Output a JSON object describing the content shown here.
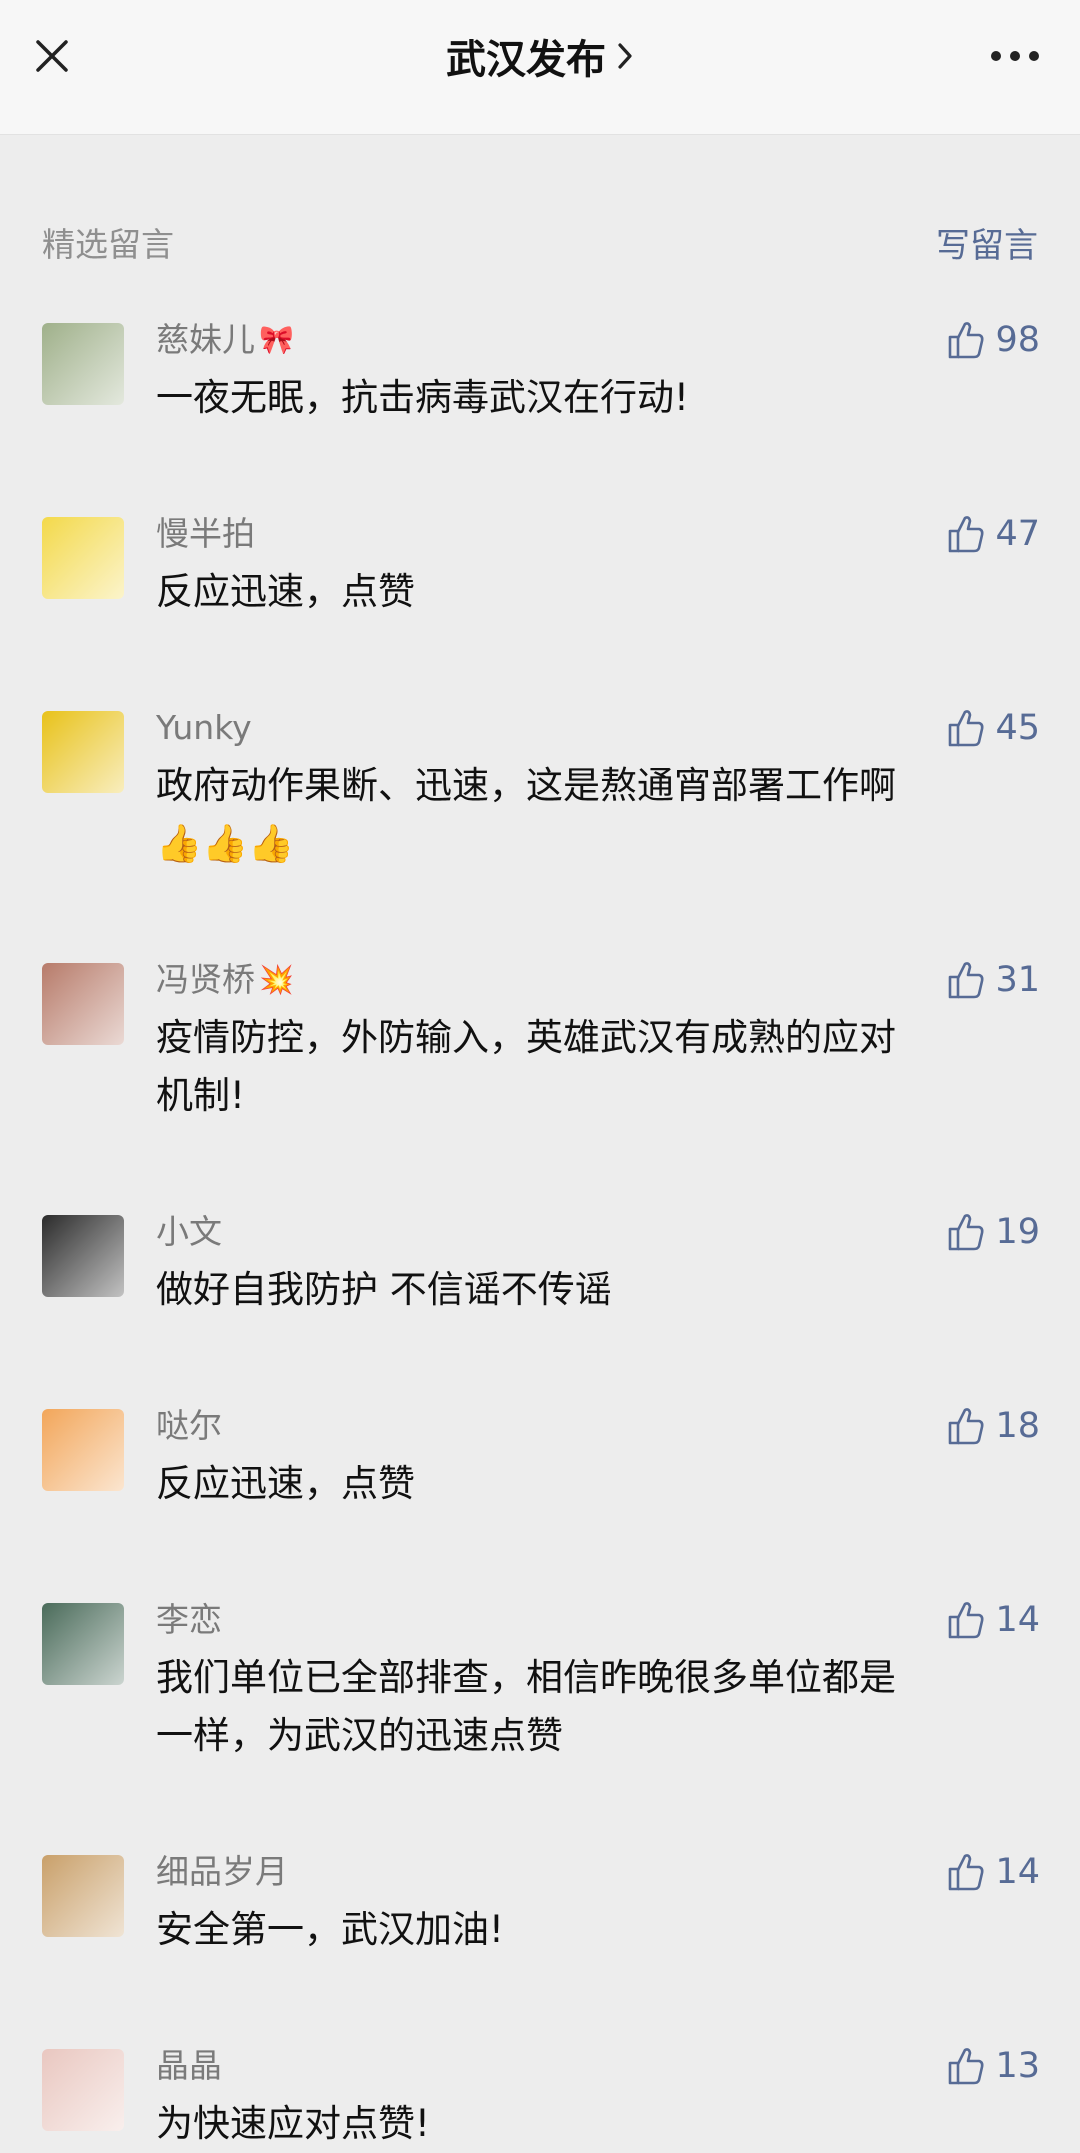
{
  "header": {
    "title": "武汉发布",
    "close_icon": "close-icon",
    "more_icon": "more-dots-icon",
    "chevron_icon": "chevron-right-icon"
  },
  "section": {
    "title": "精选留言",
    "write_label": "写留言"
  },
  "colors": {
    "link": "#576b95",
    "page_bg": "#ededed"
  },
  "comments": [
    {
      "name": "慈妹儿",
      "emoji": "🎀",
      "text": "一夜无眠，抗击病毒武汉在行动!",
      "likes": "98",
      "avatar_color": "#9fb08a"
    },
    {
      "name": "慢半拍",
      "emoji": "",
      "text": "反应迅速，点赞",
      "likes": "47",
      "avatar_color": "#f3d94a"
    },
    {
      "name": "Yunky",
      "emoji": "",
      "text": "政府动作果断、迅速，这是熬通宵部署工作啊👍👍👍",
      "likes": "45",
      "avatar_color": "#e8c21a"
    },
    {
      "name": "冯贤桥",
      "emoji": "💥",
      "text": "疫情防控，外防输入，英雄武汉有成熟的应对机制!",
      "likes": "31",
      "avatar_color": "#b77b6a"
    },
    {
      "name": "小文",
      "emoji": "",
      "text": "做好自我防护 不信谣不传谣",
      "likes": "19",
      "avatar_color": "#2b2b2b"
    },
    {
      "name": "哒尔",
      "emoji": "",
      "text": "反应迅速，点赞",
      "likes": "18",
      "avatar_color": "#f2a65a"
    },
    {
      "name": "李恋",
      "emoji": "",
      "text": "我们单位已全部排查，相信昨晚很多单位都是一样，为武汉的迅速点赞",
      "likes": "14",
      "avatar_color": "#4a6b5a"
    },
    {
      "name": "细品岁月",
      "emoji": "",
      "text": "安全第一，武汉加油!",
      "likes": "14",
      "avatar_color": "#c9a06a"
    },
    {
      "name": "晶晶",
      "emoji": "",
      "text": "为快速应对点赞!",
      "likes": "13",
      "avatar_color": "#e9c7c0"
    }
  ]
}
